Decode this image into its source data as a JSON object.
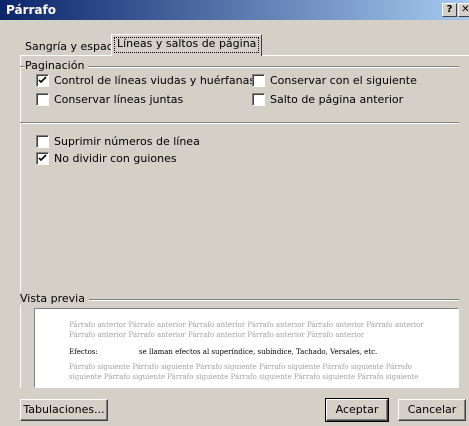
{
  "window": {
    "title": "Párrafo",
    "help": "?",
    "close": "✕"
  },
  "tabs": [
    {
      "label": "Sangría y espacio",
      "active": false
    },
    {
      "label": "Líneas y saltos de página",
      "active": true
    }
  ],
  "pagination": {
    "title": "Paginación",
    "options": [
      {
        "label": "Control de líneas viudas y huérfanas",
        "checked": true
      },
      {
        "label": "Conservar con el siguiente",
        "checked": false
      },
      {
        "label": "Conservar líneas juntas",
        "checked": false
      },
      {
        "label": "Salto de página anterior",
        "checked": false
      }
    ]
  },
  "extra_options": [
    {
      "label": "Suprimir números de línea",
      "checked": false
    },
    {
      "label": "No dividir con guiones",
      "checked": true
    }
  ],
  "preview": {
    "title": "Vista previa",
    "prev_line1": "Párrafo anterior Párrafo anterior Párrafo anterior Párrafo anterior Párrafo anterior Párrafo anterior",
    "prev_line2": "Párrafo anterior Párrafo anterior Párrafo anterior Párrafo anterior Párrafo anterior",
    "effects_label": "Efectos:",
    "effects_text": "se llaman efectos al superíndice, subíndice, Tachado, Versales, etc.",
    "next_line1": "Párrafo siguiente Párrafo siguiente Párrafo siguiente Párrafo siguiente Párrafo siguiente Párrafo",
    "next_line2": "siguiente Párrafo siguiente Párrafo siguiente Párrafo siguiente Párrafo siguiente Párrafo siguiente"
  },
  "buttons": {
    "tabs": "Tabulaciones...",
    "ok": "Aceptar",
    "cancel": "Cancelar"
  }
}
